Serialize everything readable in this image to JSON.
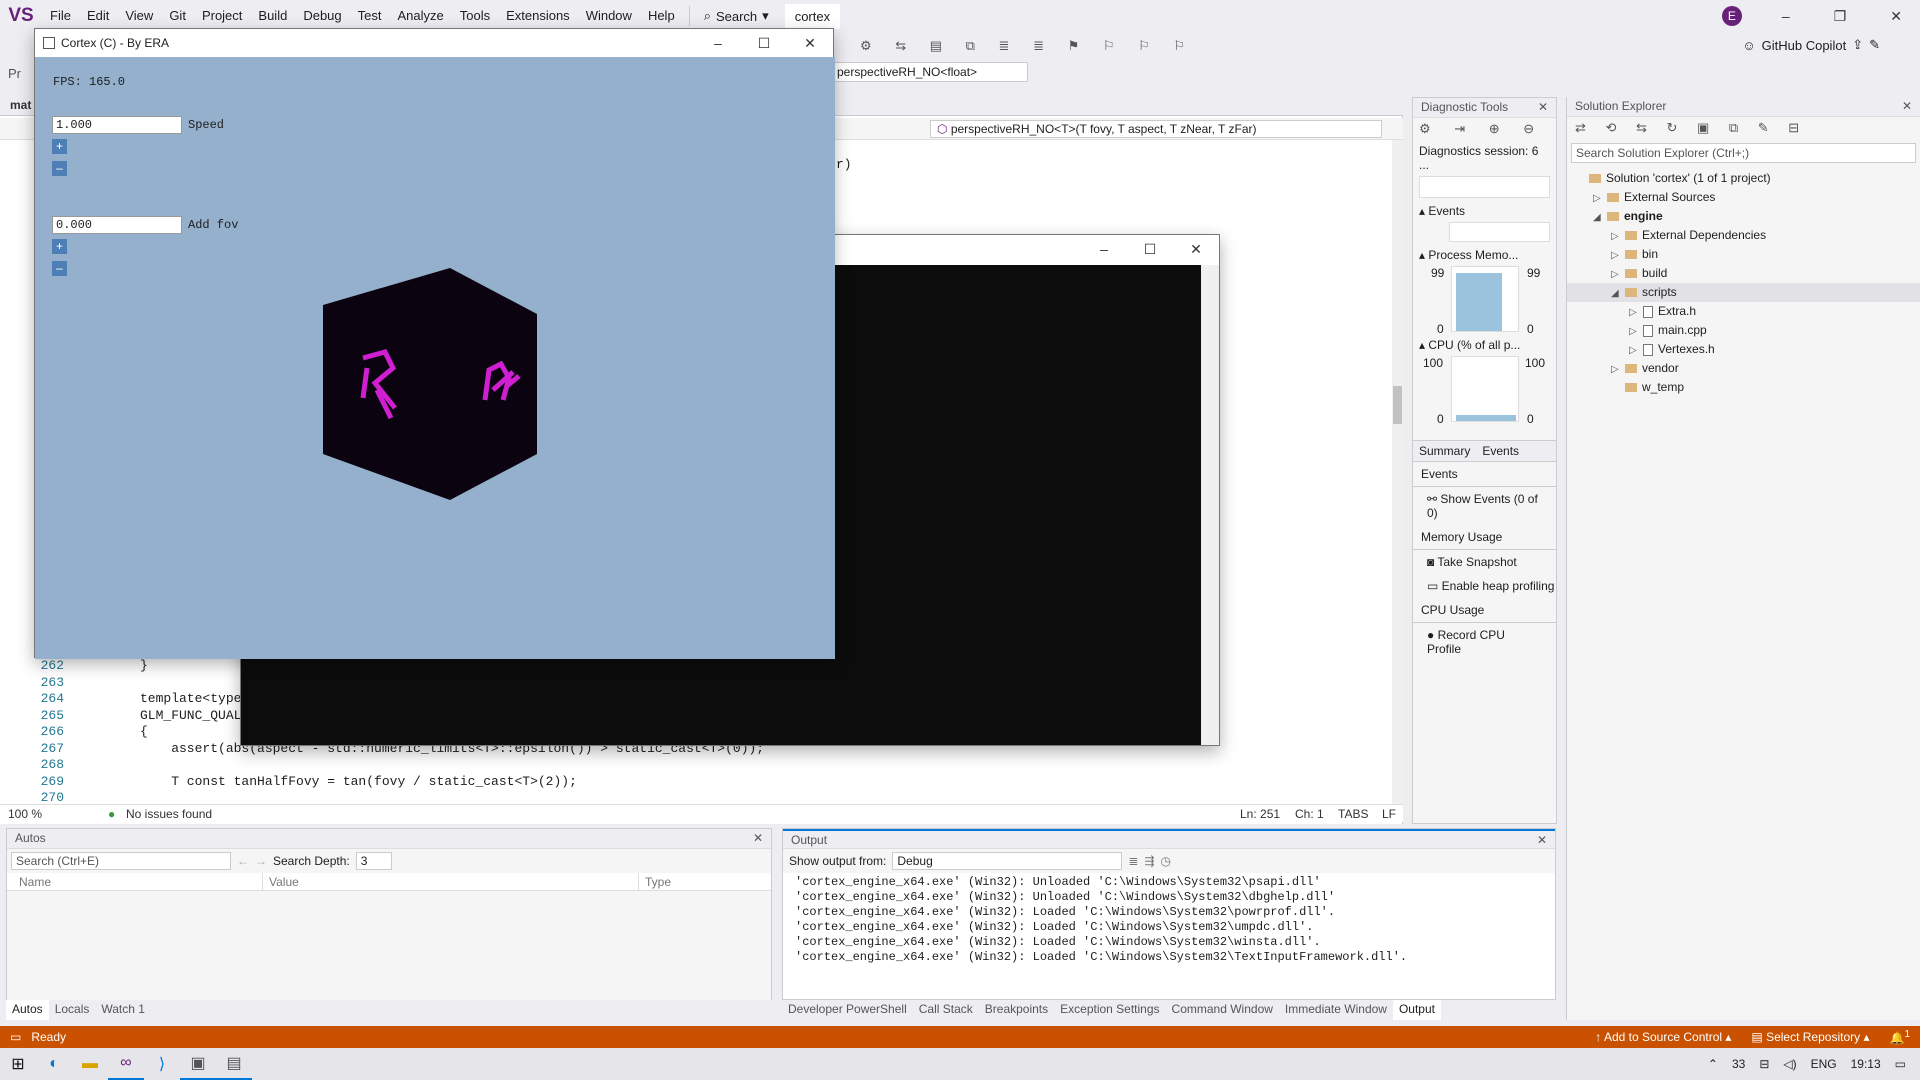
{
  "menubar": {
    "logo": "VS",
    "items": [
      "File",
      "Edit",
      "View",
      "Git",
      "Project",
      "Build",
      "Debug",
      "Test",
      "Analyze",
      "Tools",
      "Extensions",
      "Window",
      "Help"
    ],
    "search_label": "Search",
    "solution_name": "cortex",
    "account_initial": "E"
  },
  "toolbar": {
    "copilot": "GitHub Copilot",
    "scope": "perspectiveRH_NO<float>",
    "left_frag": "Pr"
  },
  "editor": {
    "tab_frag": "mat",
    "nav_member": "perspectiveRH_NO<T>(T fovy, T aspect, T zNear, T zFar)",
    "visible_fragment": "r)",
    "lines": [
      {
        "num": "262",
        "text": "}"
      },
      {
        "num": "263",
        "text": ""
      },
      {
        "num": "264",
        "text": "template<typer"
      },
      {
        "num": "265",
        "text": "GLM_FUNC_QUALI"
      },
      {
        "num": "266",
        "text": "{"
      },
      {
        "num": "267",
        "text": "    assert(abs(aspect - std::numeric_limits<T>::epsilon()) > static_cast<T>(0));"
      },
      {
        "num": "268",
        "text": ""
      },
      {
        "num": "269",
        "text": "    T const tanHalfFovy = tan(fovy / static_cast<T>(2));"
      },
      {
        "num": "270",
        "text": ""
      }
    ],
    "zoom": "100 %",
    "issues": "No issues found",
    "position": "Ln: 251",
    "column": "Ch: 1",
    "tabs": "TABS",
    "eol": "LF"
  },
  "cortex_window": {
    "title": "Cortex (C) - By ERA",
    "fps": "FPS: 165.0",
    "speed_value": "1.000",
    "speed_label": "Speed",
    "fov_value": "0.000",
    "fov_label": "Add fov",
    "plus": "+",
    "minus": "–"
  },
  "diagnostics": {
    "title": "Diagnostic Tools",
    "session": "Diagnostics session: 6 ...",
    "events": "Events",
    "process_memory": "Process Memo...",
    "mem_max": "99",
    "mem_min": "0",
    "cpu": "CPU (% of all p...",
    "cpu_max": "100",
    "cpu_min": "0",
    "tabs": [
      "Summary",
      "Events"
    ],
    "events_header": "Events",
    "show_events": "Show Events (0 of 0)",
    "memory_header": "Memory Usage",
    "take_snapshot": "Take Snapshot",
    "heap": "Enable heap profiling",
    "cpu_header": "CPU Usage",
    "record_cpu": "Record CPU Profile"
  },
  "solution_explorer": {
    "title": "Solution Explorer",
    "search_placeholder": "Search Solution Explorer (Ctrl+;)",
    "items": [
      {
        "label": "Solution 'cortex' (1 of 1 project)"
      },
      {
        "label": "External Sources"
      },
      {
        "label": "engine"
      },
      {
        "label": "External Dependencies"
      },
      {
        "label": "bin"
      },
      {
        "label": "build"
      },
      {
        "label": "scripts"
      },
      {
        "label": "Extra.h"
      },
      {
        "label": "main.cpp"
      },
      {
        "label": "Vertexes.h"
      },
      {
        "label": "vendor"
      },
      {
        "label": "w_temp"
      }
    ]
  },
  "autos": {
    "title": "Autos",
    "search_placeholder": "Search (Ctrl+E)",
    "depth_label": "Search Depth:",
    "depth_value": "3",
    "columns": [
      "Name",
      "Value",
      "Type"
    ],
    "tabs": [
      "Autos",
      "Locals",
      "Watch 1"
    ]
  },
  "output": {
    "title": "Output",
    "show_from_label": "Show output from:",
    "show_from_value": "Debug",
    "lines": [
      "'cortex_engine_x64.exe' (Win32): Unloaded 'C:\\Windows\\System32\\psapi.dll'",
      "'cortex_engine_x64.exe' (Win32): Unloaded 'C:\\Windows\\System32\\dbghelp.dll'",
      "'cortex_engine_x64.exe' (Win32): Loaded 'C:\\Windows\\System32\\powrprof.dll'.",
      "'cortex_engine_x64.exe' (Win32): Loaded 'C:\\Windows\\System32\\umpdc.dll'.",
      "'cortex_engine_x64.exe' (Win32): Loaded 'C:\\Windows\\System32\\winsta.dll'.",
      "'cortex_engine_x64.exe' (Win32): Loaded 'C:\\Windows\\System32\\TextInputFramework.dll'."
    ],
    "tabs": [
      "Developer PowerShell",
      "Call Stack",
      "Breakpoints",
      "Exception Settings",
      "Command Window",
      "Immediate Window",
      "Output"
    ]
  },
  "statusbar": {
    "ready": "Ready",
    "source_control": "Add to Source Control",
    "repo": "Select Repository",
    "notif": "1"
  },
  "taskbar": {
    "temp": "33",
    "lang": "ENG",
    "time": "19:13"
  }
}
